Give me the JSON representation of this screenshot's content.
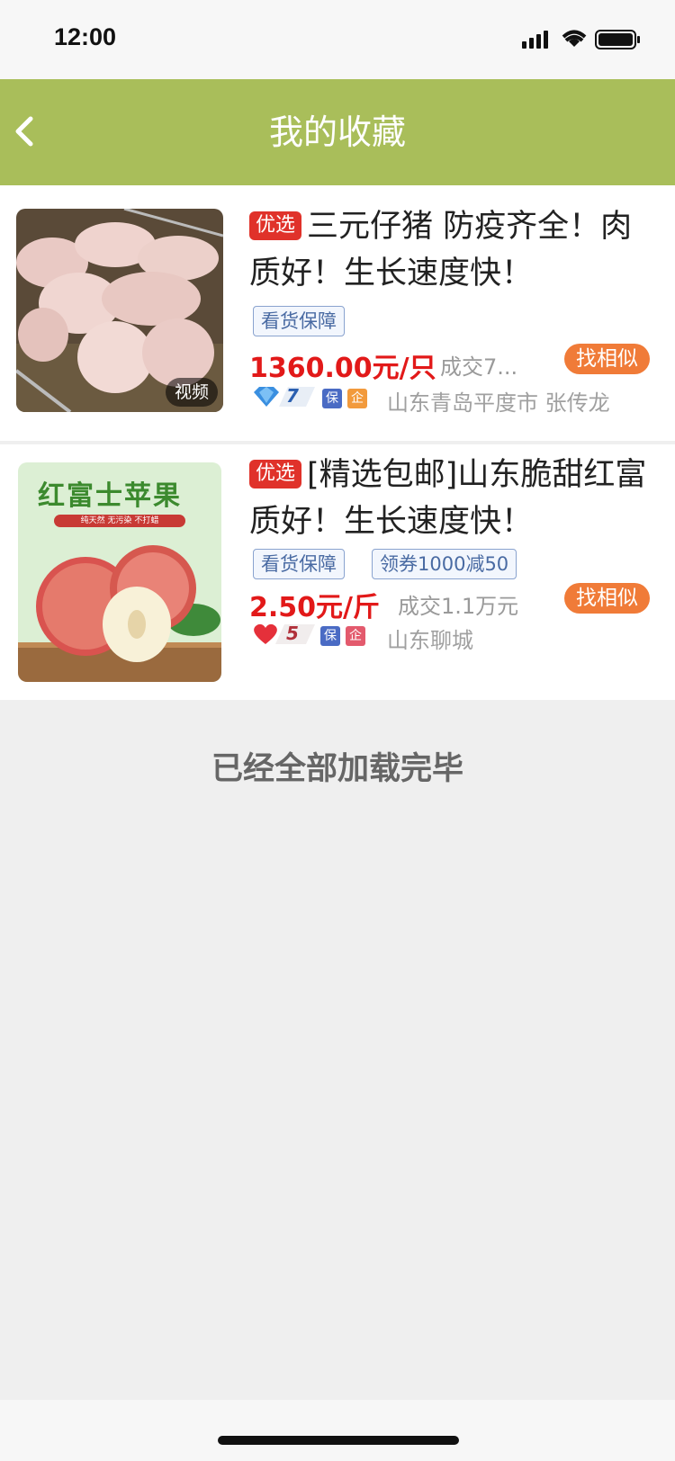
{
  "status": {
    "time": "12:00"
  },
  "nav": {
    "title": "我的收藏"
  },
  "items": [
    {
      "tag": "优选",
      "title_line1": "三元仔猪 防疫齐全！肉",
      "title_line2": "质好！生长速度快！",
      "badges": [
        "看货保障"
      ],
      "price": "1360.00元/只",
      "sold": "成交7...",
      "similar": "找相似",
      "level": "7",
      "level_icon": "diamond-icon",
      "cert_badges": [
        "保",
        "企"
      ],
      "location": "山东青岛平度市 张传龙",
      "video_label": "视频"
    },
    {
      "tag": "优选",
      "title_line1": "[精选包邮]山东脆甜红富",
      "title_line2": "质好！生长速度快！",
      "badges": [
        "看货保障",
        "领券1000减50"
      ],
      "price": "2.50元/斤",
      "sold": "成交1.1万元",
      "similar": "找相似",
      "level": "5",
      "level_icon": "heart-icon",
      "cert_badges": [
        "保",
        "企"
      ],
      "location": "山东聊城",
      "image_text": {
        "title": "红富士苹果",
        "subtitle": "纯天然 无污染 不打蜡"
      }
    }
  ],
  "footer": {
    "text": "已经全部加载完毕"
  },
  "colors": {
    "nav": "#a9be5a",
    "price": "#e21919",
    "similar_btn": "#f07b38",
    "youxuan": "#e0322a"
  }
}
